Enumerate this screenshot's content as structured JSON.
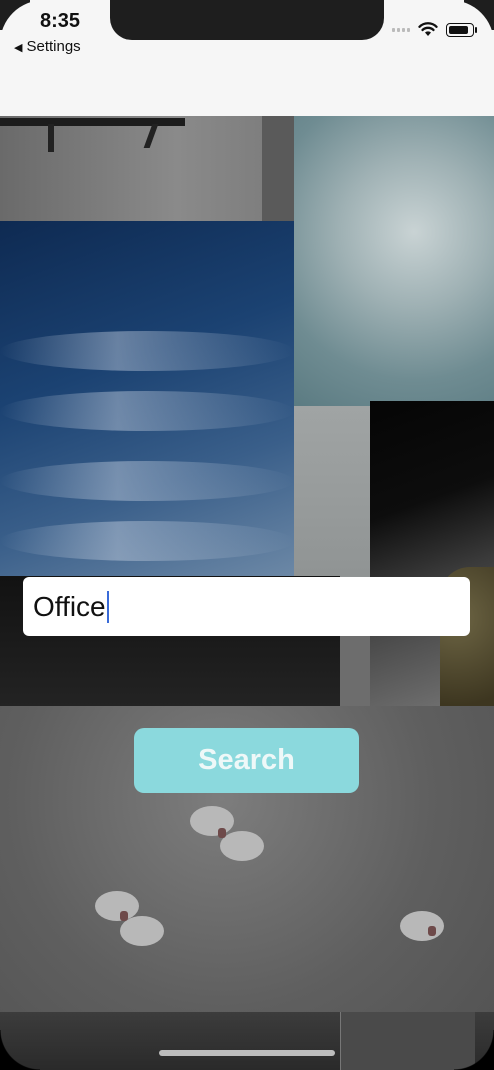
{
  "status_bar": {
    "time": "8:35",
    "back_label": "Settings",
    "wifi_icon": "wifi-icon",
    "battery_icon": "battery-icon"
  },
  "search": {
    "value": "Office"
  },
  "search_button": {
    "label": "Search",
    "color": "#8bd9dd"
  },
  "colors": {
    "nav_bar": "#f6f6f6",
    "field_bg": "#ffffff",
    "caret": "#3a6bd8"
  }
}
